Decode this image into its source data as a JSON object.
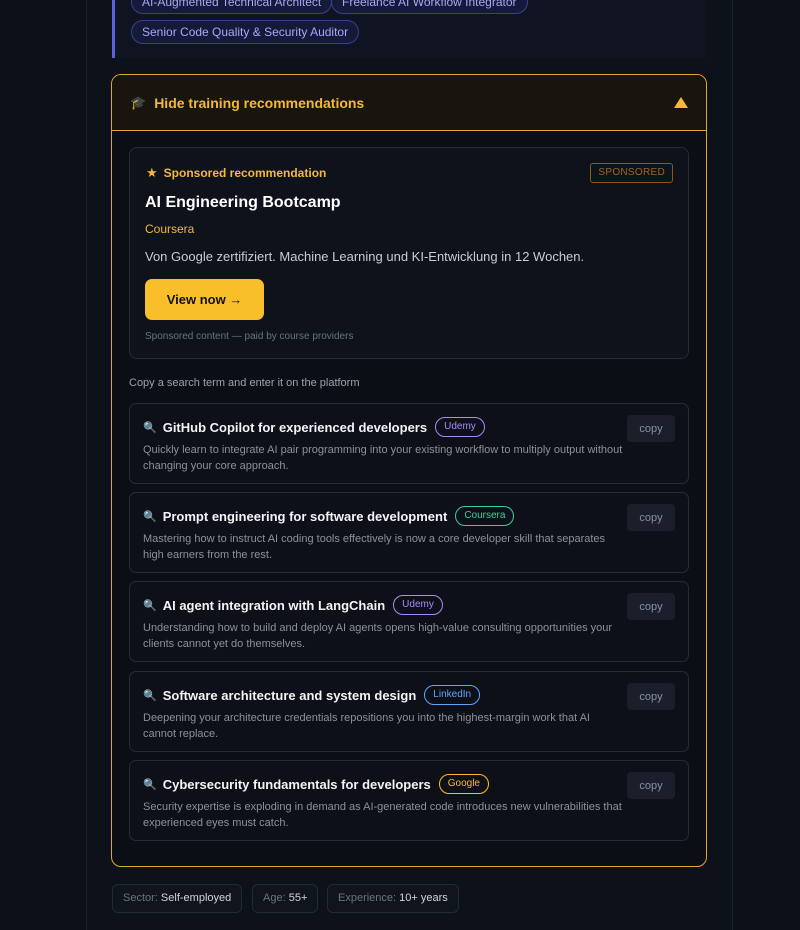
{
  "role_tags": [
    {
      "label": "AI-Augmented Technical Architect"
    },
    {
      "label": "Freelance AI Workflow Integrator"
    },
    {
      "label": "Senior Code Quality & Security Auditor"
    }
  ],
  "training": {
    "toggle_label": "Hide training recommendations",
    "sponsored": {
      "label": "Sponsored recommendation",
      "badge": "SPONSORED",
      "title": "AI Engineering Bootcamp",
      "provider": "Coursera",
      "description": "Von Google zertifiziert. Machine Learning und KI-Entwicklung in 12 Wochen.",
      "cta": "View now →",
      "footnote": "Sponsored content — paid by course providers"
    },
    "hint": "Copy a search term and enter it on the platform",
    "copy_label": "copy",
    "courses": [
      {
        "title": "GitHub Copilot for experienced developers",
        "platform": "Udemy",
        "platform_color": "#a78bfa",
        "description": "Quickly learn to integrate AI pair programming into your existing workflow to multiply output without changing your core approach."
      },
      {
        "title": "Prompt engineering for software development",
        "platform": "Coursera",
        "platform_color": "#34d399",
        "description": "Mastering how to instruct AI coding tools effectively is now a core developer skill that separates high earners from the rest."
      },
      {
        "title": "AI agent integration with LangChain",
        "platform": "Udemy",
        "platform_color": "#a78bfa",
        "description": "Understanding how to build and deploy AI agents opens high-value consulting opportunities your clients cannot yet do themselves."
      },
      {
        "title": "Software architecture and system design",
        "platform": "LinkedIn",
        "platform_color": "#60a5fa",
        "description": "Deepening your architecture credentials repositions you into the highest-margin work that AI cannot replace."
      },
      {
        "title": "Cybersecurity fundamentals for developers",
        "platform": "Google",
        "platform_color": "#fbbf24",
        "description": "Security expertise is exploding in demand as AI-generated code introduces new vulnerabilities that experienced eyes must catch."
      }
    ]
  },
  "meta": [
    {
      "key": "Sector:",
      "value": "Self-employed"
    },
    {
      "key": "Age:",
      "value": "55+"
    },
    {
      "key": "Experience:",
      "value": "10+ years"
    }
  ],
  "colors": {
    "accent": "#f5b83a",
    "cta": "#f8bf2a",
    "role_tag": "#a5a9f5"
  },
  "icons": {
    "toggle": "graduation-cap-icon",
    "sponsor": "star-icon",
    "course": "magnifier-icon"
  }
}
